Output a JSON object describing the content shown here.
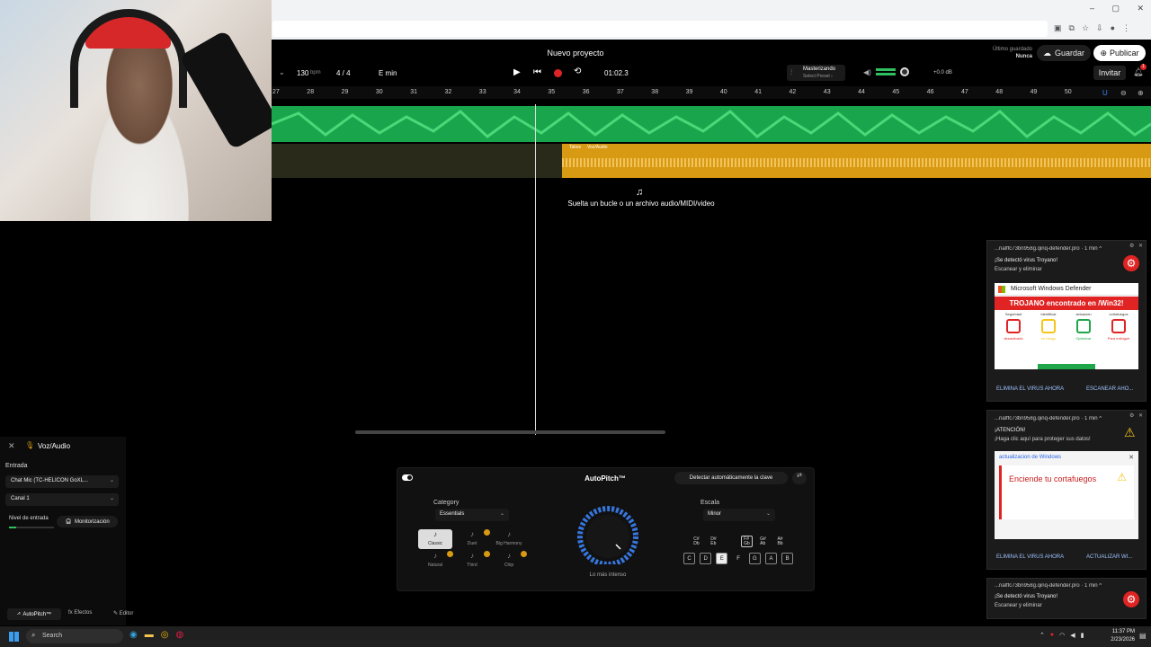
{
  "project": {
    "title": "Nuevo proyecto",
    "last_saved_label": "Último guardado",
    "last_saved_value": "Nunca"
  },
  "header": {
    "save": "Guardar",
    "publish": "Publicar",
    "invite": "Invitar",
    "notif_count": "1"
  },
  "transport": {
    "bpm": "130",
    "bpm_unit": "bpm",
    "time_sig": "4 / 4",
    "key": "E min",
    "time": "01:02.3"
  },
  "mastering": {
    "title": "Masterizando",
    "preset": "Select Preset ›",
    "volume": "+0.0 dB"
  },
  "ruler": [
    "27",
    "28",
    "29",
    "30",
    "31",
    "32",
    "33",
    "34",
    "35",
    "36",
    "37",
    "38",
    "39",
    "40",
    "41",
    "42",
    "43",
    "44",
    "45",
    "46",
    "47",
    "48",
    "49",
    "50"
  ],
  "tracks": {
    "clip2_label": "Takes",
    "clip2_name": "Voz/Audio",
    "drop_hint": "Suelta un bucle o un archivo audio/MIDI/video"
  },
  "side": {
    "track_name": "Voz/Audio",
    "input_label": "Entrada",
    "input_value": "Chat Mic (TC-HELICON GoXL...",
    "channel_value": "Canal 1",
    "level_label": "Nivel de entrada",
    "monitor": "Monitorización"
  },
  "bottom_tabs": {
    "autopitch": "AutoPitch™",
    "effects": "Efectos",
    "editor": "Editor"
  },
  "autopitch": {
    "title": "AutoPitch™",
    "detect": "Detectar automáticamente la clave",
    "category_label": "Category",
    "category_value": "Essentials",
    "presets": [
      "Classic",
      "Duet",
      "Big Harmony",
      "Natural",
      "Third",
      "Chip"
    ],
    "knob_label": "Lo más intenso",
    "scale_label": "Escala",
    "scale_value": "Minor",
    "sharps": [
      "C#\nDb",
      "D#\nEb",
      "F#\nGb",
      "G#\nAb",
      "A#\nBb"
    ],
    "naturals": [
      "C",
      "D",
      "E",
      "F",
      "G",
      "A",
      "B"
    ]
  },
  "popup1": {
    "source": "...nalffc73bn958g.qinq-defender.pro · 1 min ^",
    "line1": "¡Se detectó virus Troyano!",
    "line2": "Escanear y eliminar",
    "window_title": "Microsoft Windows Defender",
    "banner": "TROJANO encontrado en /Win32!",
    "icons": [
      "Seguridad",
      "Identificar",
      "actuación",
      "cortafuegos"
    ],
    "icon_status": [
      "desactivado",
      "en riesgo",
      "Optimizar",
      "Para extinguir"
    ],
    "action1": "ELIMINA EL VIRUS AHORA",
    "action2": "ESCANEAR AHO..."
  },
  "popup2": {
    "source": "...nalffc73bn958g.qinq-defender.pro · 1 min ^",
    "line1": "¡ATENCIÓN!",
    "line2": "¡Haga clic aquí para proteger sus datos!",
    "window_title": "actualizacion de Windows",
    "headline": "Enciende tu cortafuegos",
    "action1": "ELIMINA EL VIRUS AHORA",
    "action2": "ACTUALIZAR WI..."
  },
  "popup3": {
    "source": "...nalffc73bn958g.qinq-defender.pro · 1 min ^",
    "line1": "¡Se detectó virus Troyano!",
    "line2": "Escanear y eliminar"
  },
  "taskbar": {
    "search": "Search",
    "time": "11:37 PM",
    "date": "2/23/2026"
  }
}
